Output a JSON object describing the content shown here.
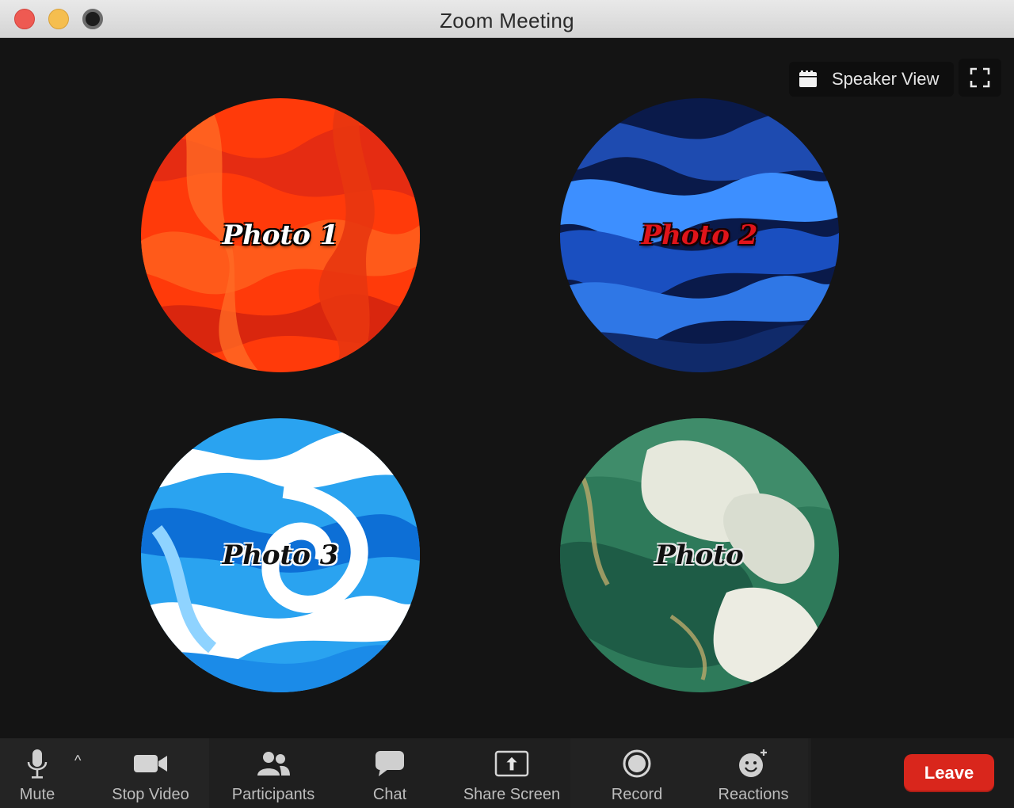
{
  "window": {
    "title": "Zoom Meeting"
  },
  "view_controls": {
    "speaker_view_label": "Speaker View",
    "speaker_view_icon": "grid-icon",
    "fullscreen_icon": "fullscreen-icon"
  },
  "participants": [
    {
      "label": "Photo 1",
      "colors": [
        "#ff3a0a",
        "#e52c12",
        "#ff5a1a"
      ]
    },
    {
      "label": "Photo 2",
      "colors": [
        "#0a1a4a",
        "#1a4fc0",
        "#3d8fff"
      ]
    },
    {
      "label": "Photo 3",
      "colors": [
        "#2aa3f0",
        "#0d6fd6",
        "#ffffff"
      ]
    },
    {
      "label": "Photo",
      "colors": [
        "#1e5c46",
        "#3f8c6a",
        "#e6e8dc"
      ]
    }
  ],
  "toolbar": {
    "mute_label": "Mute",
    "mute_icon": "microphone-icon",
    "caret": "^",
    "stop_video_label": "Stop Video",
    "stop_video_icon": "video-camera-icon",
    "participants_label": "Participants",
    "participants_icon": "people-icon",
    "chat_label": "Chat",
    "chat_icon": "chat-bubble-icon",
    "share_screen_label": "Share Screen",
    "share_screen_icon": "share-screen-icon",
    "record_label": "Record",
    "record_icon": "record-icon",
    "reactions_label": "Reactions",
    "reactions_icon": "smiley-plus-icon",
    "leave_label": "Leave"
  },
  "colors": {
    "leave": "#d9261c",
    "stage_bg": "#141414",
    "toolbar_bg": "#1f1f1f"
  }
}
